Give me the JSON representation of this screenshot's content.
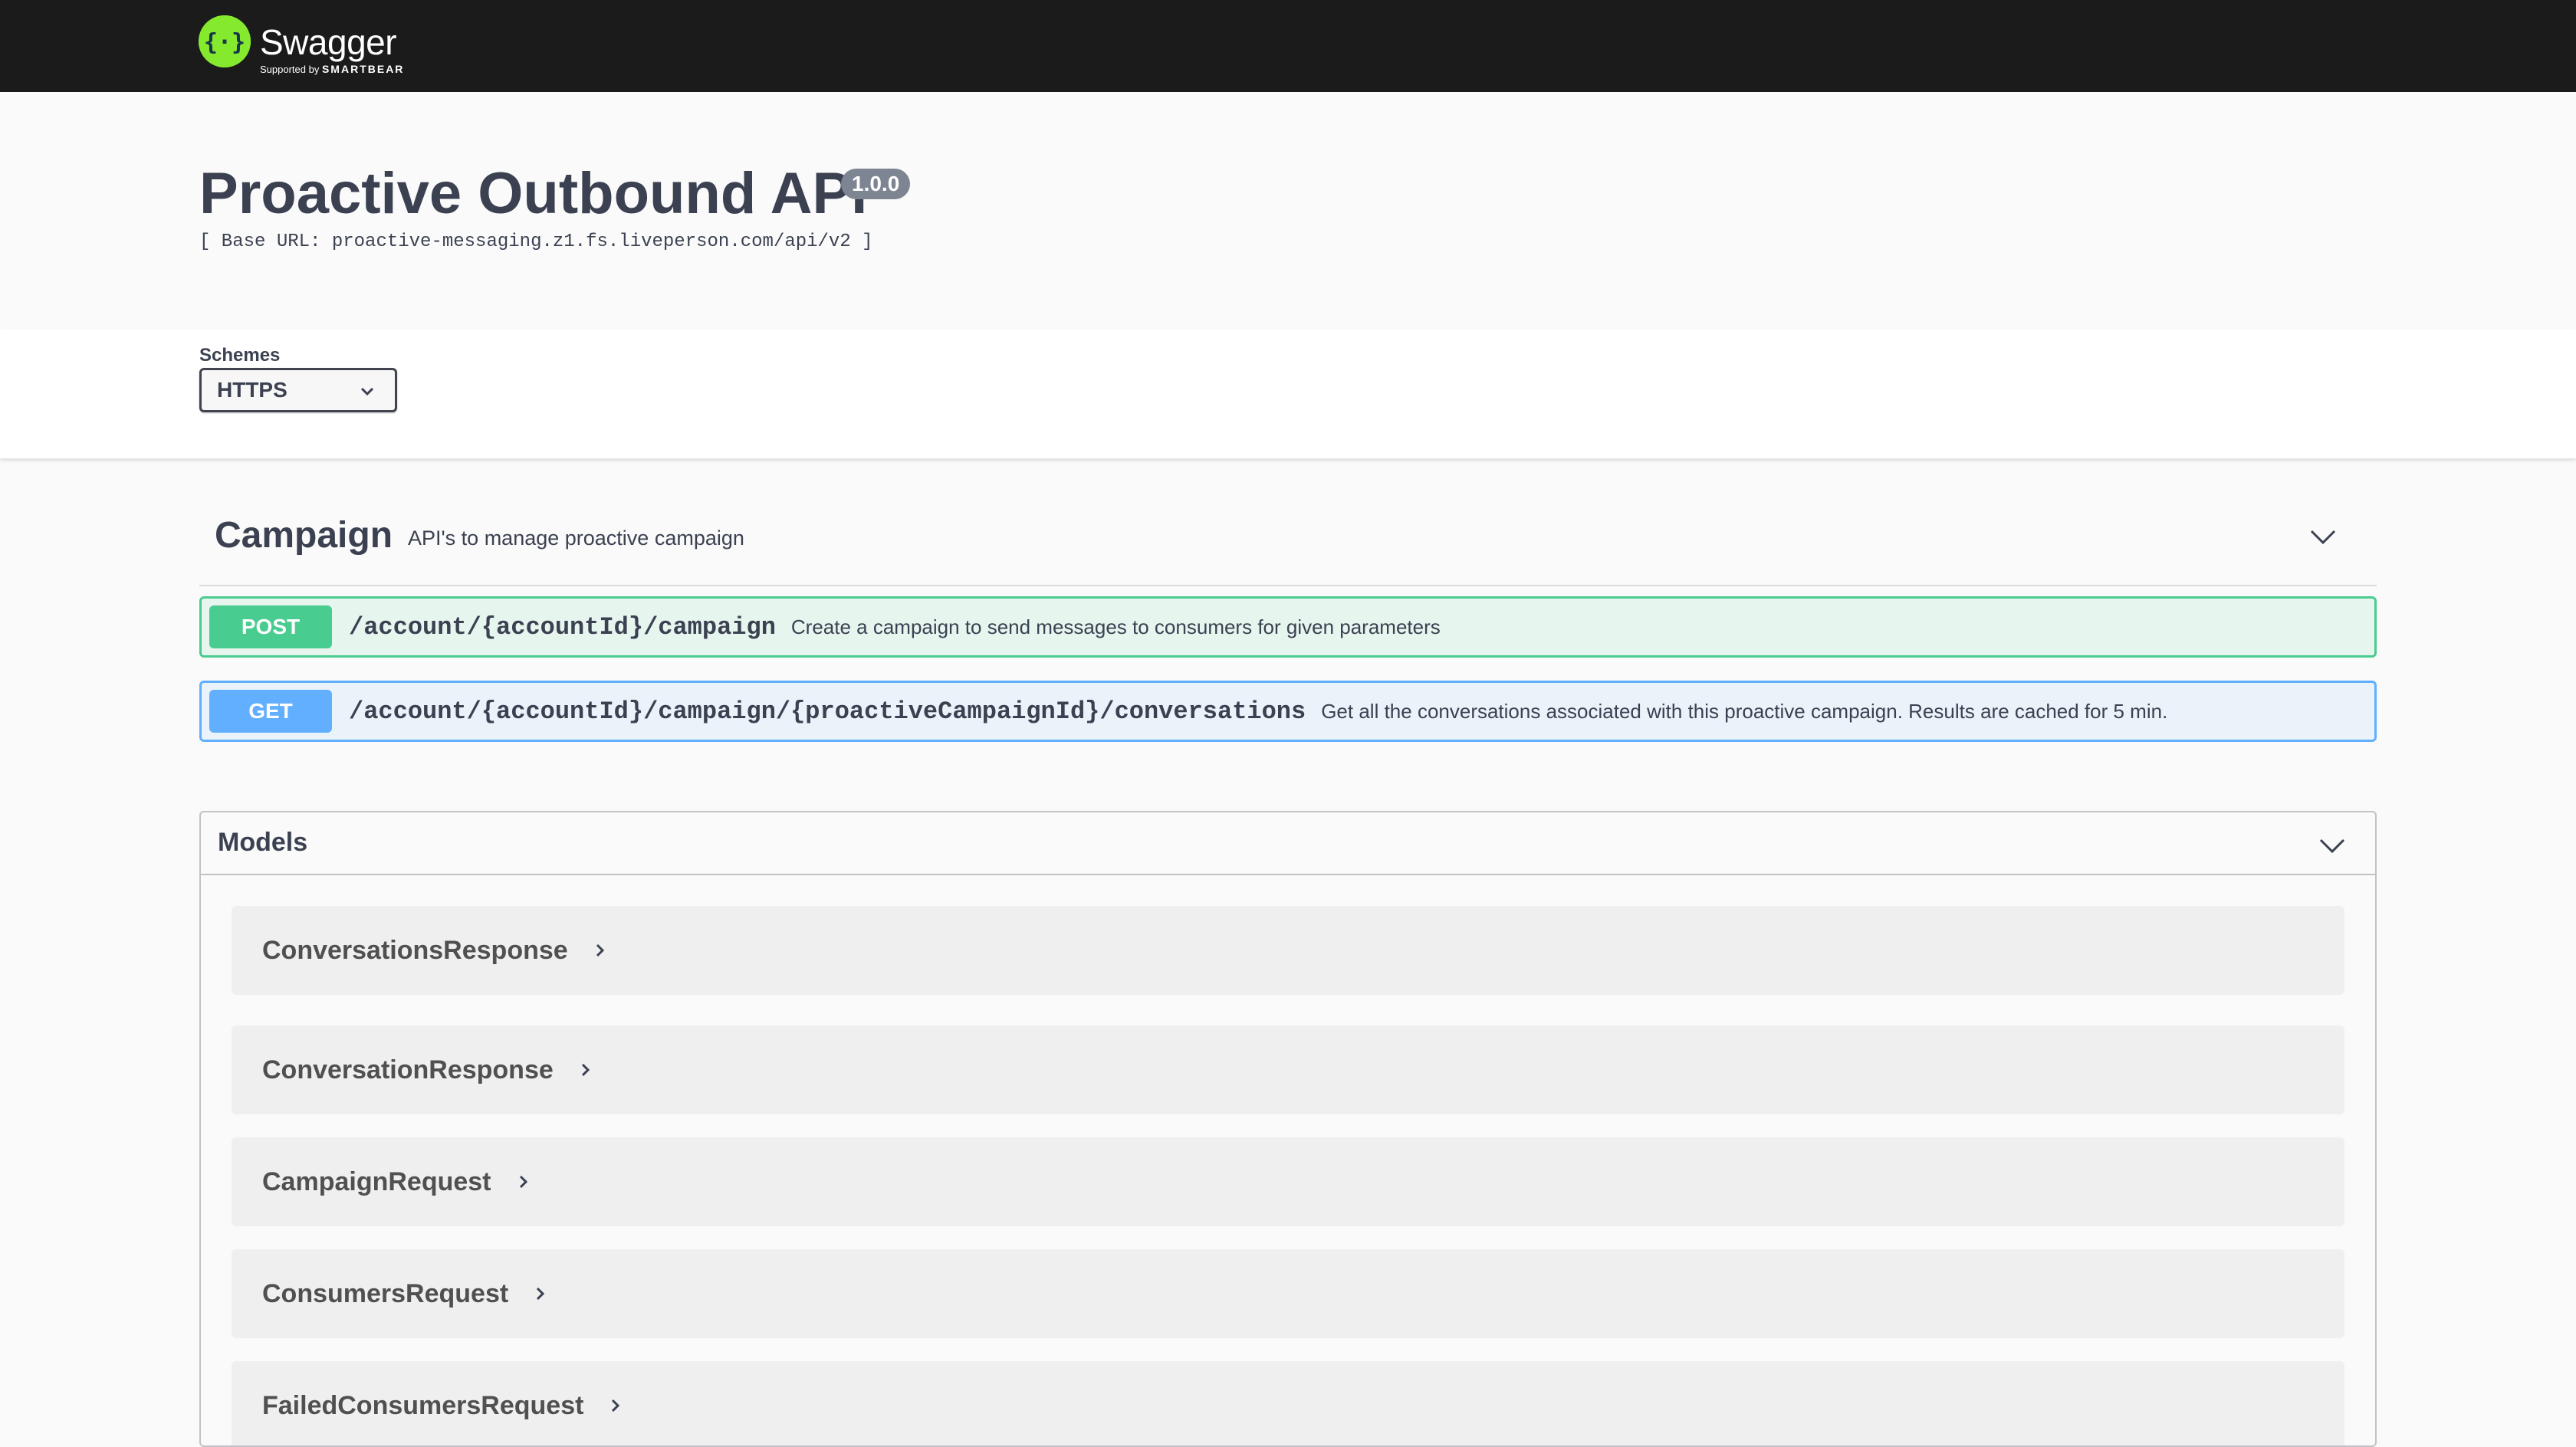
{
  "topbar": {
    "logo_title": "Swagger",
    "logo_supported_by": "Supported by",
    "logo_brand": "SMARTBEAR",
    "brand_color": "#85ea2d"
  },
  "info": {
    "title": "Proactive Outbound API",
    "version": "1.0.0",
    "base_url": "[ Base URL: proactive-messaging.z1.fs.liveperson.com/api/v2 ]"
  },
  "schemes": {
    "label": "Schemes",
    "selected": "HTTPS"
  },
  "tag": {
    "name": "Campaign",
    "description": "API's to manage proactive campaign",
    "operations": [
      {
        "method": "POST",
        "path": "/account/{accountId}/campaign",
        "summary": "Create a campaign to send messages to consumers for given parameters",
        "color": "#49cc90"
      },
      {
        "method": "GET",
        "path": "/account/{accountId}/campaign/{proactiveCampaignId}/conversations",
        "summary": "Get all the conversations associated with this proactive campaign. Results are cached for 5 min.",
        "color": "#61affe"
      }
    ]
  },
  "models": {
    "title": "Models",
    "items": [
      "ConversationsResponse",
      "ConversationResponse",
      "CampaignRequest",
      "ConsumersRequest",
      "FailedConsumersRequest"
    ]
  }
}
